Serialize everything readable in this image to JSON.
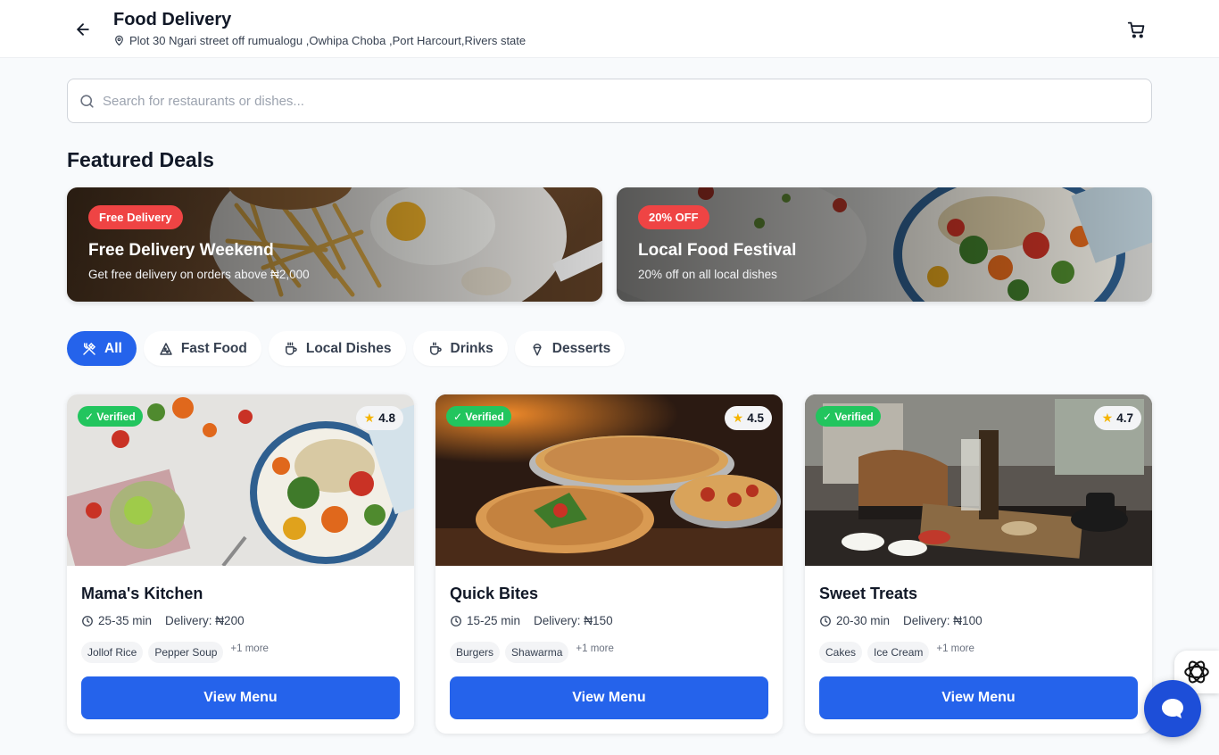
{
  "header": {
    "title": "Food Delivery",
    "address": "Plot 30 Ngari street off rumualogu ,Owhipa Choba ,Port Harcourt,Rivers state",
    "icons": [
      "arrow-left-icon",
      "map-pin-icon",
      "cart-icon"
    ]
  },
  "search": {
    "placeholder": "Search for restaurants or dishes...",
    "value": "",
    "icon": "search-icon"
  },
  "featured": {
    "title": "Featured Deals",
    "deals": [
      {
        "badge": "Free Delivery",
        "title": "Free Delivery Weekend",
        "subtitle": "Get free delivery on orders above ₦2,000"
      },
      {
        "badge": "20% OFF",
        "title": "Local Food Festival",
        "subtitle": "20% off on all local dishes"
      }
    ]
  },
  "categories": [
    {
      "label": "All",
      "icon": "utensils-crossed-icon",
      "active": true
    },
    {
      "label": "Fast Food",
      "icon": "pizza-slice-icon",
      "active": false
    },
    {
      "label": "Local Dishes",
      "icon": "cup-icon",
      "active": false
    },
    {
      "label": "Drinks",
      "icon": "coffee-icon",
      "active": false
    },
    {
      "label": "Desserts",
      "icon": "ice-cream-icon",
      "active": false
    }
  ],
  "restaurants": [
    {
      "name": "Mama's Kitchen",
      "verified": "✓ Verified",
      "rating": "4.8",
      "time": "25-35 min",
      "delivery": "Delivery: ₦200",
      "tags": [
        "Jollof Rice",
        "Pepper Soup"
      ],
      "more": "+1 more",
      "button": "View Menu"
    },
    {
      "name": "Quick Bites",
      "verified": "✓ Verified",
      "rating": "4.5",
      "time": "15-25 min",
      "delivery": "Delivery: ₦150",
      "tags": [
        "Burgers",
        "Shawarma"
      ],
      "more": "+1 more",
      "button": "View Menu"
    },
    {
      "name": "Sweet Treats",
      "verified": "✓ Verified",
      "rating": "4.7",
      "time": "20-30 min",
      "delivery": "Delivery: ₦100",
      "tags": [
        "Cakes",
        "Ice Cream"
      ],
      "more": "+1 more",
      "button": "View Menu"
    }
  ],
  "colors": {
    "primary": "#2563eb",
    "badge_red": "#ef4444",
    "verified_green": "#22c55e",
    "star": "#f5b400",
    "background": "#f8fafc"
  }
}
